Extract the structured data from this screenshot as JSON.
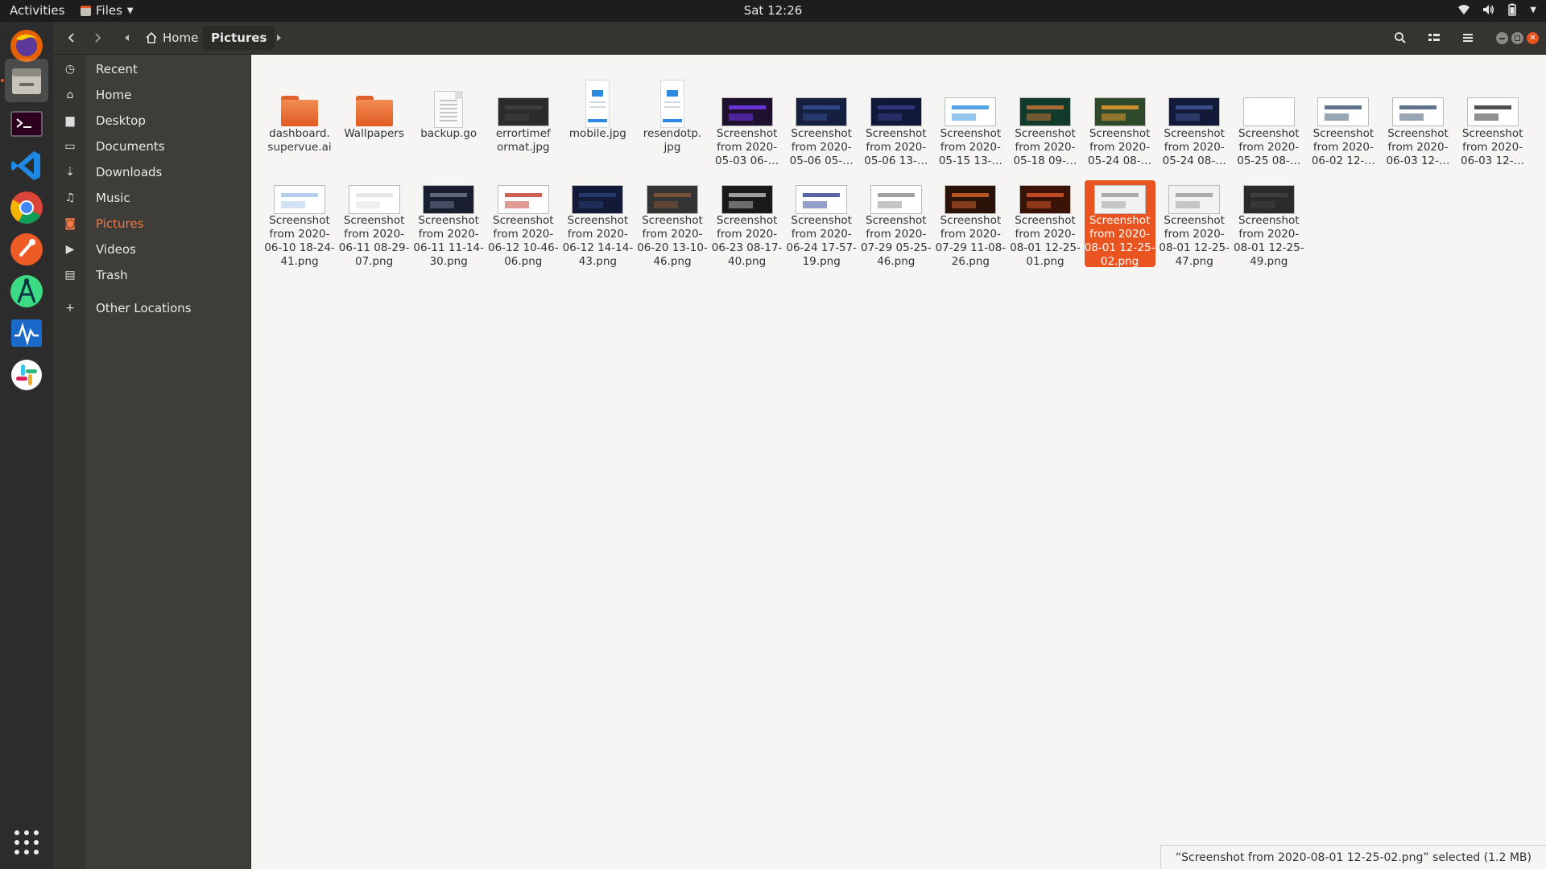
{
  "topbar": {
    "activities": "Activities",
    "app_name": "Files",
    "clock": "Sat 12:26",
    "icons": [
      "wifi-icon",
      "volume-icon",
      "battery-icon",
      "chevron-down-icon"
    ]
  },
  "dock": {
    "apps": [
      "Firefox",
      "Files",
      "Terminal",
      "Visual Studio Code",
      "Google Chrome",
      "Postman",
      "Android Studio",
      "System Monitor",
      "Slack"
    ],
    "show_apps": "Show Applications"
  },
  "header": {
    "breadcrumb": {
      "home": "Home",
      "current": "Pictures"
    }
  },
  "sidebar": {
    "items": [
      {
        "label": "Recent",
        "icon": "clock-icon"
      },
      {
        "label": "Home",
        "icon": "home-icon"
      },
      {
        "label": "Desktop",
        "icon": "folder-icon"
      },
      {
        "label": "Documents",
        "icon": "document-icon"
      },
      {
        "label": "Downloads",
        "icon": "download-icon"
      },
      {
        "label": "Music",
        "icon": "music-icon"
      },
      {
        "label": "Pictures",
        "icon": "camera-icon",
        "active": true
      },
      {
        "label": "Videos",
        "icon": "video-icon"
      },
      {
        "label": "Trash",
        "icon": "trash-icon"
      },
      {
        "label": "Other Locations",
        "icon": "plus-icon"
      }
    ]
  },
  "files": [
    {
      "name": "dashboard.\nsupervue.ai",
      "kind": "folder"
    },
    {
      "name": "Wallpapers",
      "kind": "folder"
    },
    {
      "name": "backup.go",
      "kind": "text"
    },
    {
      "name": "errortimef\normat.jpg",
      "kind": "image"
    },
    {
      "name": "mobile.jpg",
      "kind": "image"
    },
    {
      "name": "resendotp.\njpg",
      "kind": "image"
    },
    {
      "name": "Screenshot\nfrom 2020-\n05-03 06-…",
      "kind": "image"
    },
    {
      "name": "Screenshot\nfrom 2020-\n05-06 05-…",
      "kind": "image"
    },
    {
      "name": "Screenshot\nfrom 2020-\n05-06 13-…",
      "kind": "image"
    },
    {
      "name": "Screenshot\nfrom 2020-\n05-15 13-…",
      "kind": "image"
    },
    {
      "name": "Screenshot\nfrom 2020-\n05-18 09-…",
      "kind": "image"
    },
    {
      "name": "Screenshot\nfrom 2020-\n05-24 08-…",
      "kind": "image"
    },
    {
      "name": "Screenshot\nfrom 2020-\n05-24 08-…",
      "kind": "image"
    },
    {
      "name": "Screenshot\nfrom 2020-\n05-25 08-…",
      "kind": "image"
    },
    {
      "name": "Screenshot\nfrom 2020-\n06-02 12-…",
      "kind": "image"
    },
    {
      "name": "Screenshot\nfrom 2020-\n06-03 12-…",
      "kind": "image"
    },
    {
      "name": "Screenshot\nfrom 2020-\n06-03 12-…",
      "kind": "image"
    },
    {
      "name": "Screenshot\nfrom 2020-\n06-10 18-24-\n41.png",
      "kind": "image"
    },
    {
      "name": "Screenshot\nfrom 2020-\n06-11 08-29-\n07.png",
      "kind": "image"
    },
    {
      "name": "Screenshot\nfrom 2020-\n06-11 11-14-\n30.png",
      "kind": "image"
    },
    {
      "name": "Screenshot\nfrom 2020-\n06-12 10-46-\n06.png",
      "kind": "image"
    },
    {
      "name": "Screenshot\nfrom 2020-\n06-12 14-14-\n43.png",
      "kind": "image"
    },
    {
      "name": "Screenshot\nfrom 2020-\n06-20 13-10-\n46.png",
      "kind": "image"
    },
    {
      "name": "Screenshot\nfrom 2020-\n06-23 08-17-\n40.png",
      "kind": "image"
    },
    {
      "name": "Screenshot\nfrom 2020-\n06-24 17-57-\n19.png",
      "kind": "image"
    },
    {
      "name": "Screenshot\nfrom 2020-\n07-29 05-25-\n46.png",
      "kind": "image"
    },
    {
      "name": "Screenshot\nfrom 2020-\n07-29 11-08-\n26.png",
      "kind": "image"
    },
    {
      "name": "Screenshot\nfrom 2020-\n08-01 12-25-\n01.png",
      "kind": "image"
    },
    {
      "name": "Screenshot\nfrom 2020-\n08-01 12-25-\n02.png",
      "kind": "image",
      "selected": true
    },
    {
      "name": "Screenshot\nfrom 2020-\n08-01 12-25-\n47.png",
      "kind": "image"
    },
    {
      "name": "Screenshot\nfrom 2020-\n08-01 12-25-\n49.png",
      "kind": "image"
    }
  ],
  "status": "“Screenshot from 2020-08-01 12-25-02.png” selected  (1.2 MB)",
  "colors": {
    "accent": "#e95420",
    "sidebar_bg": "#3e3d39",
    "header_bg": "#353431",
    "content_bg": "#f6f5f4"
  }
}
